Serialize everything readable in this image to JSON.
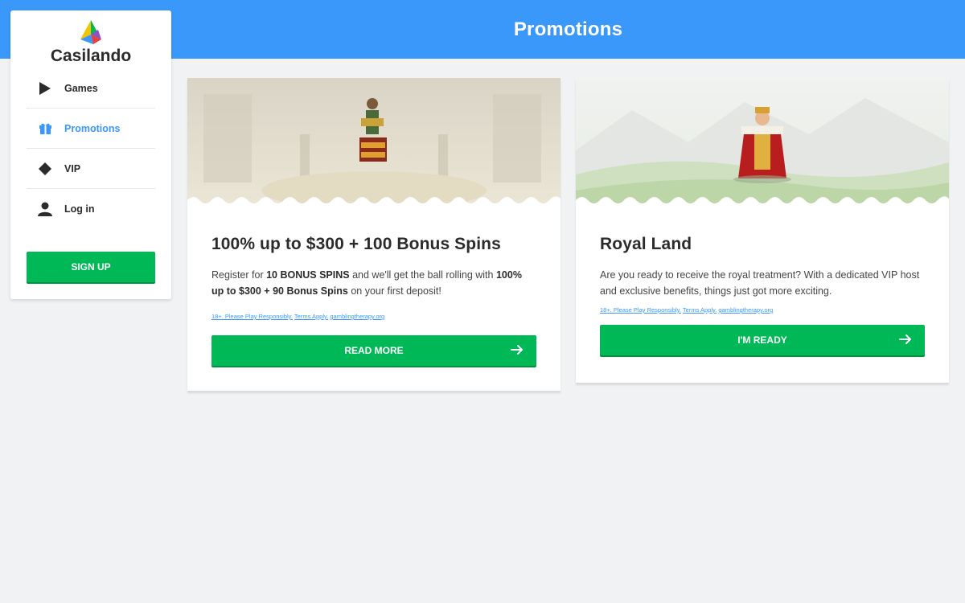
{
  "header": {
    "title": "Promotions"
  },
  "brand": {
    "name": "Casilando"
  },
  "sidebar": {
    "items": [
      {
        "label": "Games",
        "icon": "play-icon"
      },
      {
        "label": "Promotions",
        "icon": "gift-icon",
        "active": true
      },
      {
        "label": "VIP",
        "icon": "diamond-icon"
      },
      {
        "label": "Log in",
        "icon": "user-icon"
      }
    ],
    "signup_label": "SIGN UP"
  },
  "promotions": [
    {
      "title": "100% up to $300 + 100 Bonus Spins",
      "desc_parts": [
        "Register for ",
        "10 BONUS SPINS",
        " and we'll get the ball rolling with ",
        "100% up to $300 + 90 Bonus Spins",
        " on your first deposit!"
      ],
      "terms": [
        "18+. Please Play Responsibly.",
        "Terms Apply.",
        "gamblingtherapy.org"
      ],
      "cta": "READ MORE"
    },
    {
      "title": "Royal Land",
      "desc": "Are you ready to receive the royal treatment? With a dedicated VIP host and exclusive benefits, things just got more exciting.",
      "terms": [
        "18+. Please Play Responsibly.",
        "Terms Apply.",
        "gamblingtherapy.org"
      ],
      "cta": "I'M READY"
    }
  ],
  "colors": {
    "header_blue": "#3a98fa",
    "cta_green": "#00b856",
    "page_bg": "#f1f2f4"
  }
}
